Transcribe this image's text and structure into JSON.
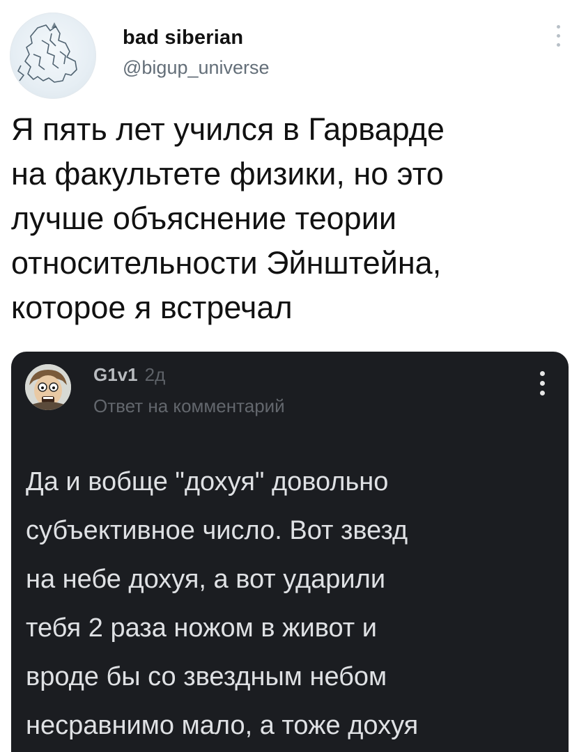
{
  "tweet": {
    "author": {
      "display_name": "bad siberian",
      "handle": "@bigup_universe",
      "avatar_icon": "siberia-map-icon"
    },
    "text_lines": [
      "Я пять лет учился в Гарварде",
      "на факультете физики, но это",
      "лучше объяснение теории",
      "относительности Эйнштейна,",
      "которое я встречал"
    ],
    "more_icon": "vertical-ellipsis-icon"
  },
  "embedded_comment": {
    "username": "G1v1",
    "time_ago": "2д",
    "reply_label": "Ответ на комментарий",
    "avatar_icon": "cartoon-face-icon",
    "more_icon": "vertical-ellipsis-icon",
    "text_lines": [
      "Да и вобще \"дохуя\" довольно",
      "субъективное число. Вот звезд",
      "на небе дохуя, а вот ударили",
      "тебя 2 раза ножом в живот и",
      "вроде бы со звездным небом",
      "несравнимо мало, а тоже дохуя"
    ],
    "colors": {
      "background": "#1b1d21",
      "text": "#dfe1e4",
      "muted": "#63676d"
    }
  }
}
